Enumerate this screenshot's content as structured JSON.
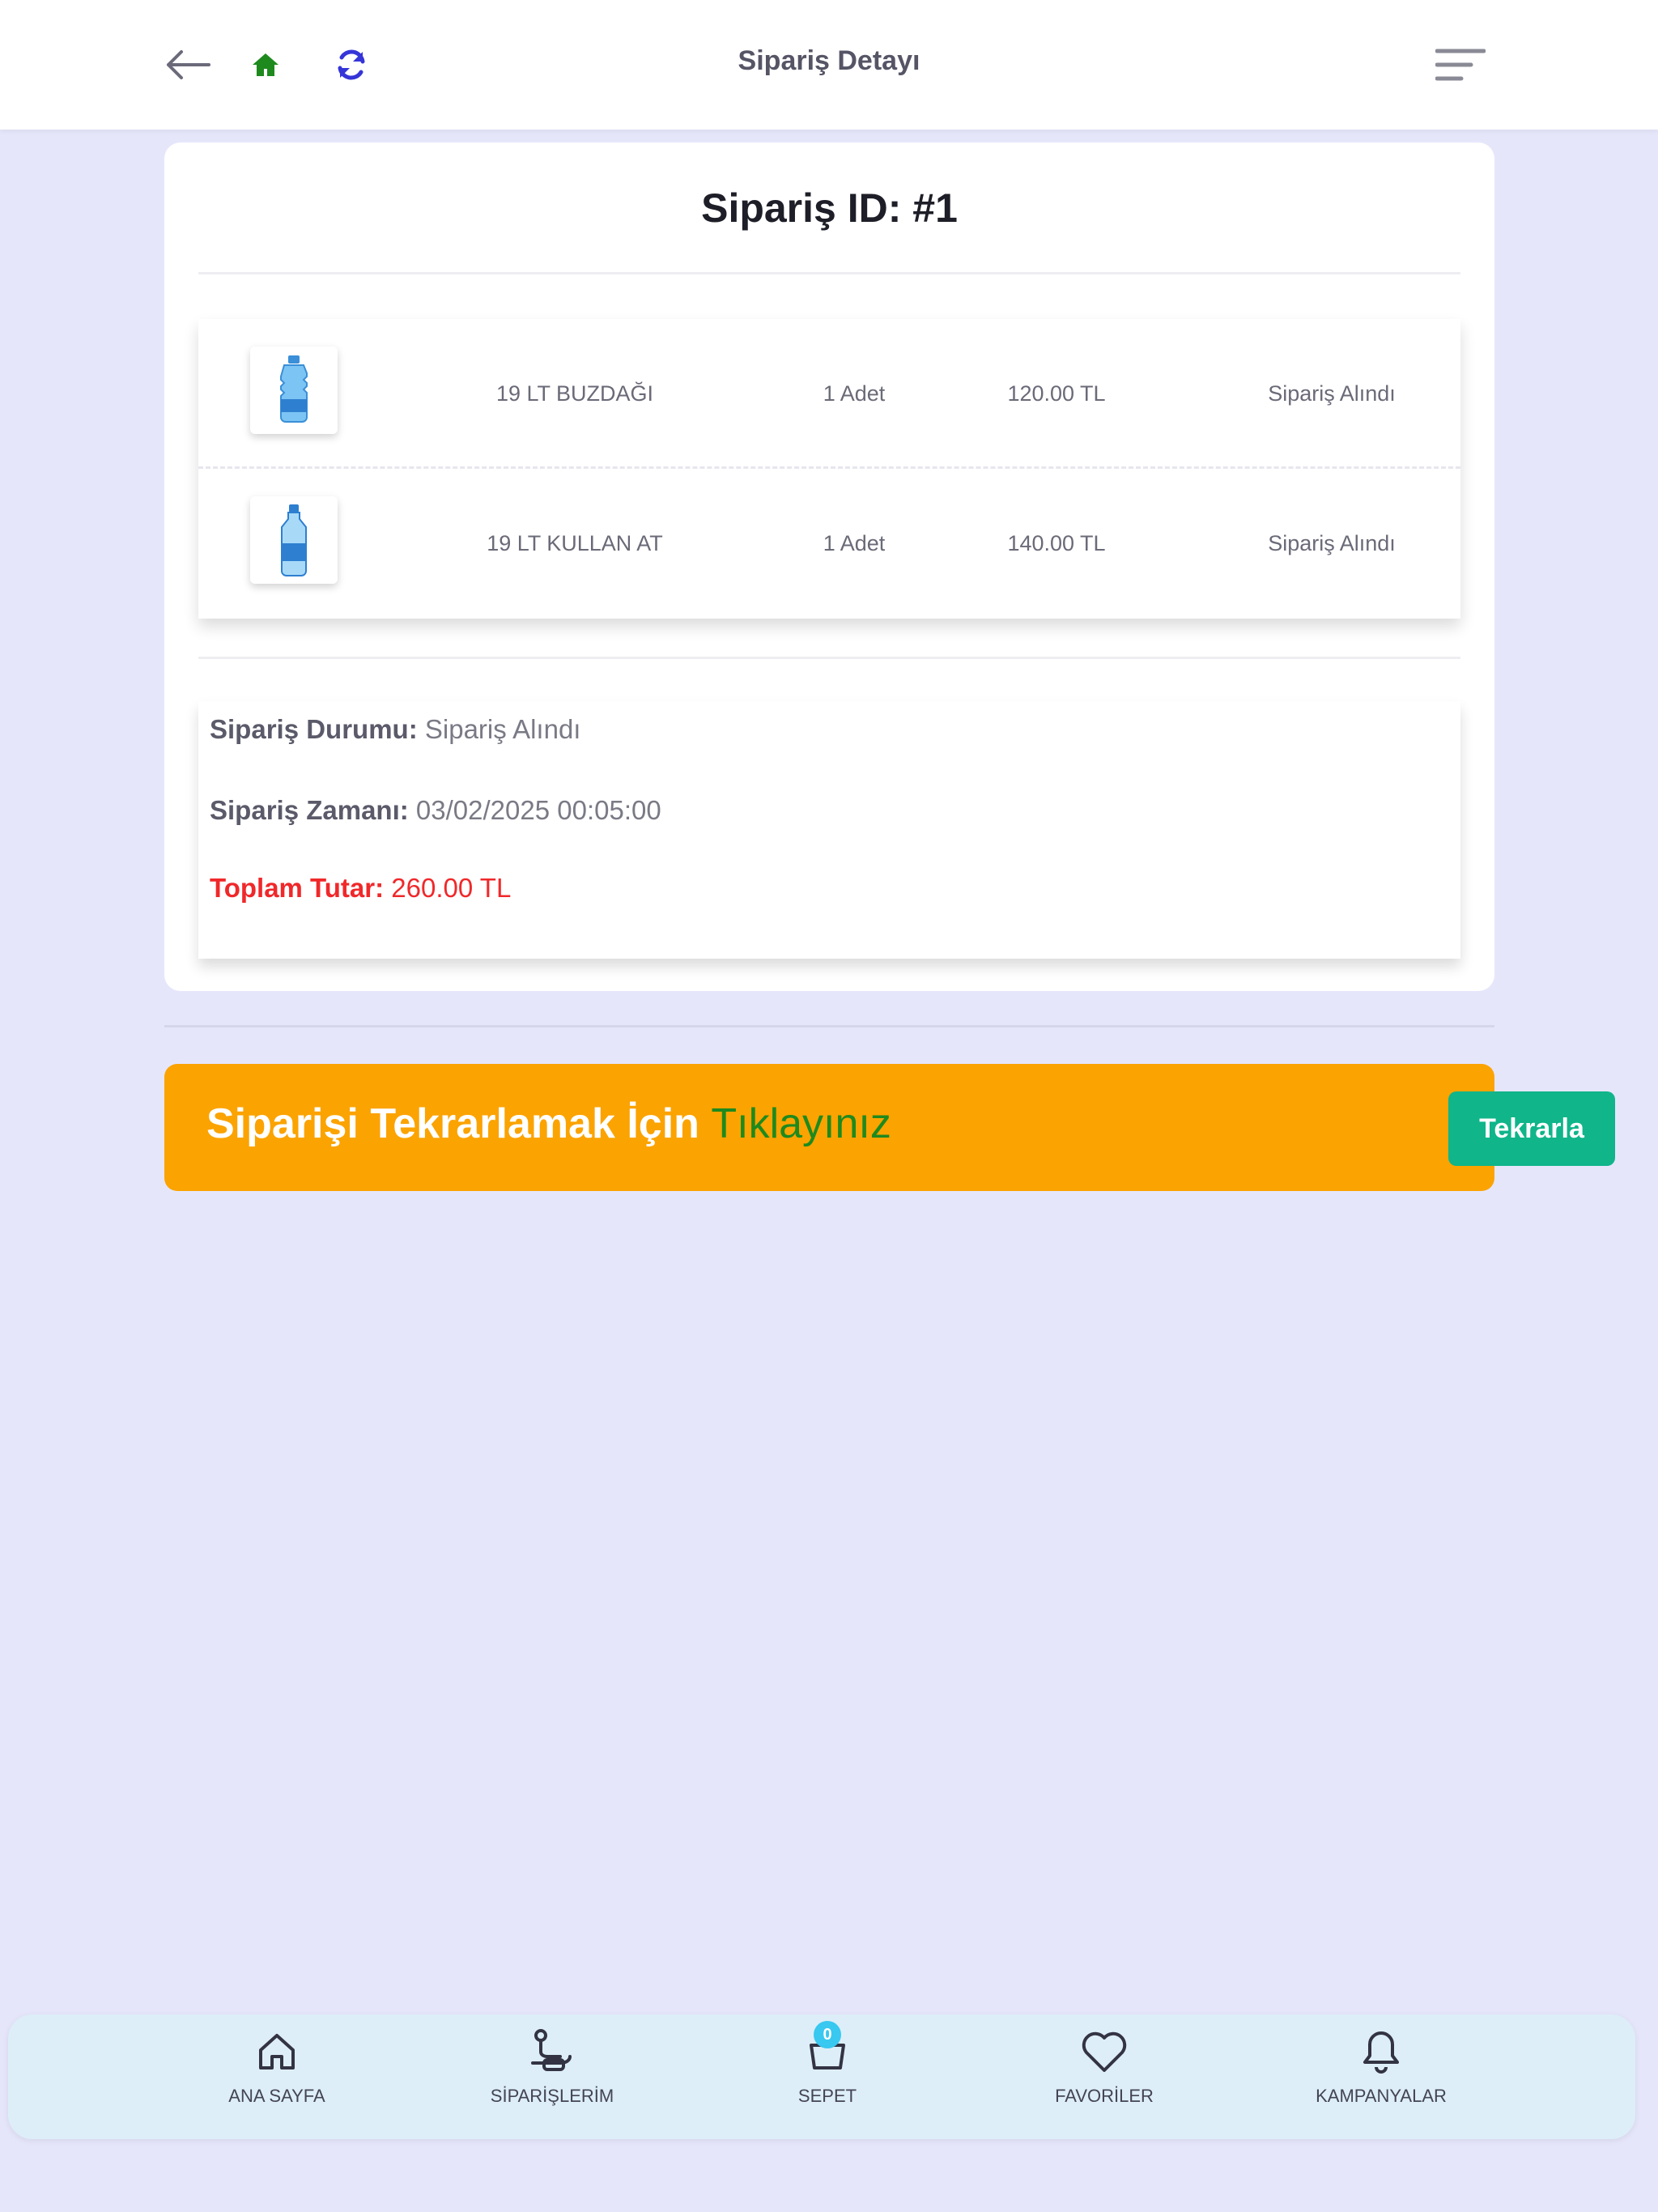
{
  "header": {
    "title": "Sipariş Detayı",
    "icons": [
      "back-arrow-icon",
      "home-icon",
      "refresh-icon",
      "menu-icon"
    ],
    "home_icon_color": "#1e8a1e",
    "refresh_icon_color": "#3535d8"
  },
  "order": {
    "title": "Sipariş ID: #1",
    "items": [
      {
        "name": "19 LT BUZDAĞI",
        "qty": "1 Adet",
        "price": "120.00 TL",
        "status": "Sipariş Alındı"
      },
      {
        "name": "19 LT KULLAN AT",
        "qty": "1 Adet",
        "price": "140.00 TL",
        "status": "Sipariş Alındı"
      }
    ],
    "summary": {
      "status_label": "Sipariş Durumu:",
      "status_value": "Sipariş Alındı",
      "time_label": "Sipariş Zamanı:",
      "time_value": "03/02/2025 00:05:00",
      "total_label": "Toplam Tutar:",
      "total_value": "260.00 TL"
    }
  },
  "repeat_banner": {
    "text": "Siparişi Tekrarlamak İçin",
    "link_text": "Tıklayınız",
    "button_label": "Tekrarla",
    "bg_color": "#fba300",
    "button_color": "#10b58a"
  },
  "bottom_nav": {
    "items": [
      {
        "label": "ANA SAYFA",
        "icon": "home-outline-icon"
      },
      {
        "label": "SİPARİŞLERİM",
        "icon": "orders-icon"
      },
      {
        "label": "SEPET",
        "icon": "cart-icon",
        "badge": "0"
      },
      {
        "label": "FAVORİLER",
        "icon": "heart-icon"
      },
      {
        "label": "KAMPANYALAR",
        "icon": "bell-icon"
      }
    ]
  },
  "colors": {
    "page_bg": "#e6e6fb",
    "total_red": "#f0282a"
  }
}
